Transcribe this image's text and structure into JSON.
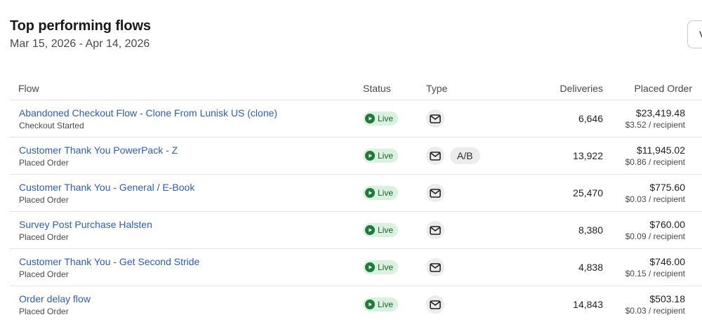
{
  "header": {
    "title": "Top performing flows",
    "date_range": "Mar 15, 2026 - Apr 14, 2026",
    "view_button_label": "V"
  },
  "table": {
    "columns": {
      "flow": "Flow",
      "status": "Status",
      "type": "Type",
      "deliveries": "Deliveries",
      "placed_order": "Placed Order"
    },
    "rows": [
      {
        "name": "Abandoned Checkout Flow - Clone From Lunisk US (clone)",
        "trigger": "Checkout Started",
        "status": "Live",
        "type_icon": "email-icon",
        "ab": "",
        "deliveries": "6,646",
        "placed_total": "$23,419.48",
        "per_recipient": "$3.52 / recipient"
      },
      {
        "name": "Customer Thank You PowerPack - Z",
        "trigger": "Placed Order",
        "status": "Live",
        "type_icon": "email-icon",
        "ab": "A/B",
        "deliveries": "13,922",
        "placed_total": "$11,945.02",
        "per_recipient": "$0.86 / recipient"
      },
      {
        "name": "Customer Thank You - General / E-Book",
        "trigger": "Placed Order",
        "status": "Live",
        "type_icon": "email-icon",
        "ab": "",
        "deliveries": "25,470",
        "placed_total": "$775.60",
        "per_recipient": "$0.03 / recipient"
      },
      {
        "name": "Survey Post Purchase Halsten",
        "trigger": "Placed Order",
        "status": "Live",
        "type_icon": "email-icon",
        "ab": "",
        "deliveries": "8,380",
        "placed_total": "$760.00",
        "per_recipient": "$0.09 / recipient"
      },
      {
        "name": "Customer Thank You - Get Second Stride",
        "trigger": "Placed Order",
        "status": "Live",
        "type_icon": "email-icon",
        "ab": "",
        "deliveries": "4,838",
        "placed_total": "$746.00",
        "per_recipient": "$0.15 / recipient"
      },
      {
        "name": "Order delay flow",
        "trigger": "Placed Order",
        "status": "Live",
        "type_icon": "email-icon",
        "ab": "",
        "deliveries": "14,843",
        "placed_total": "$503.18",
        "per_recipient": "$0.03 / recipient"
      }
    ]
  },
  "colors": {
    "link": "#2c5cc5",
    "live_badge_bg": "#d9f2df",
    "live_icon": "#1e7b3a"
  }
}
